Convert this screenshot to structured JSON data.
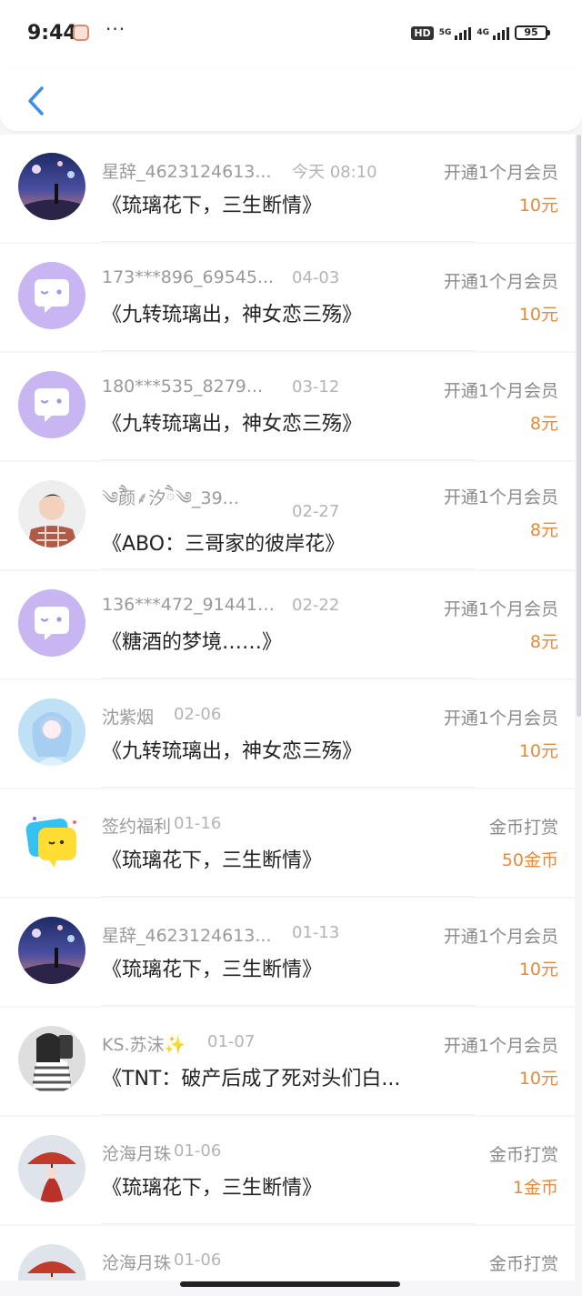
{
  "status_bar": {
    "time": "9:44",
    "more": "···",
    "battery": "95",
    "net5g": "5G",
    "net4g": "4G",
    "hd": "HD"
  },
  "rows": [
    {
      "name": "星辞_4623124613...",
      "date": "今天 08:10",
      "title": "《琉璃花下，三生断情》",
      "action": "开通1个月会员",
      "amount": "10元",
      "avatar": "anime-night-sky"
    },
    {
      "name": "173***896_69545...",
      "date": "04-03",
      "title": "《九转琉璃出，神女恋三殇》",
      "action": "开通1个月会员",
      "amount": "10元",
      "avatar": "default-chat"
    },
    {
      "name": "180***535_8279...",
      "date": "03-12",
      "title": "《九转琉璃出，神女恋三殇》",
      "action": "开通1个月会员",
      "amount": "8元",
      "avatar": "default-chat"
    },
    {
      "name": "༄ཻ颜⸙汐ཻ༄_39...",
      "date": "02-27",
      "title": "《ABO：三哥家的彼岸花》",
      "action": "开通1个月会员",
      "amount": "8元",
      "avatar": "person-plaid"
    },
    {
      "name": "136***472_914417...",
      "date": "02-22",
      "title": "《糖酒的梦境……》",
      "action": "开通1个月会员",
      "amount": "8元",
      "avatar": "default-chat"
    },
    {
      "name": "沈紫烟",
      "date": "02-06",
      "title": "《九转琉璃出，神女恋三殇》",
      "action": "开通1个月会员",
      "amount": "10元",
      "avatar": "anime-blue-girl"
    },
    {
      "name": "签约福利",
      "date": "01-16",
      "title": "《琉璃花下，三生断情》",
      "action": "金币打赏",
      "amount": "50金币",
      "avatar": "welfare-chat"
    },
    {
      "name": "星辞_4623124613...",
      "date": "01-13",
      "title": "《琉璃花下，三生断情》",
      "action": "开通1个月会员",
      "amount": "10元",
      "avatar": "anime-night-sky"
    },
    {
      "name": "KS.苏沫✨",
      "date": "01-07",
      "title": "《TNT：破产后成了死对头们白...",
      "action": "开通1个月会员",
      "amount": "10元",
      "avatar": "person-striped"
    },
    {
      "name": "沧海月珠",
      "date": "01-06",
      "title": "《琉璃花下，三生断情》",
      "action": "金币打赏",
      "amount": "1金币",
      "avatar": "anime-red-umbrella"
    },
    {
      "name": "沧海月珠",
      "date": "01-06",
      "title": "",
      "action": "金币打赏",
      "amount": "",
      "avatar": "anime-red-umbrella"
    }
  ],
  "colors": {
    "amount": "#e58a3b",
    "avatar_default": "#c8b6f2",
    "back": "#3f8ee6"
  }
}
